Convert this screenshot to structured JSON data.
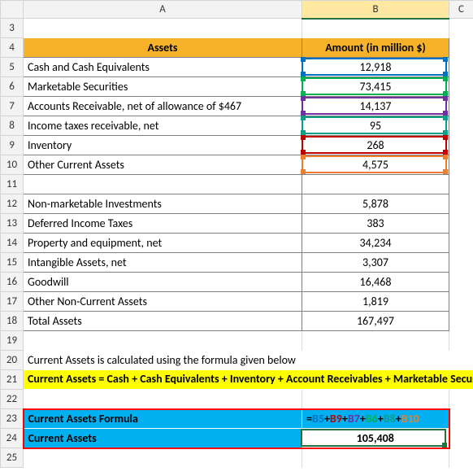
{
  "columns": {
    "rowhead": "",
    "A": "A",
    "B": "B",
    "C": "C"
  },
  "rows": [
    "3",
    "4",
    "5",
    "6",
    "7",
    "8",
    "9",
    "10",
    "11",
    "12",
    "13",
    "14",
    "15",
    "16",
    "17",
    "18",
    "19",
    "20",
    "21",
    "22",
    "23",
    "24",
    "25"
  ],
  "header": {
    "assets": "Assets",
    "amount": "Amount (in million $)"
  },
  "assets_current": [
    {
      "label": "Cash and Cash Equivalents",
      "value": "12,918"
    },
    {
      "label": "Marketable Securities",
      "value": "73,415"
    },
    {
      "label": "Accounts Receivable, net of allowance of $467",
      "value": "14,137"
    },
    {
      "label": "Income taxes receivable, net",
      "value": "95"
    },
    {
      "label": "Inventory",
      "value": "268"
    },
    {
      "label": "Other Current Assets",
      "value": "4,575"
    }
  ],
  "assets_noncurrent": [
    {
      "label": "Non-marketable Investments",
      "value": "5,878"
    },
    {
      "label": "Deferred Income Taxes",
      "value": "383"
    },
    {
      "label": "Property and equipment, net",
      "value": "34,234"
    },
    {
      "label": "Intangible Assets, net",
      "value": "3,307"
    },
    {
      "label": "Goodwill",
      "value": "16,468"
    },
    {
      "label": "Other Non-Current Assets",
      "value": "1,819"
    },
    {
      "label": "Total Assets",
      "value": "167,497"
    }
  ],
  "note_line": "Current Assets is calculated using the formula given below",
  "formula_note": "Current Assets = Cash + Cash Equivalents + Inventory + Account Receivables + Marketable Securities + Prepaid Expenses + Other Liquid Assets",
  "result": {
    "formula_label": "Current Assets Formula",
    "formula_tokens": [
      "=",
      "B5",
      "+",
      "B9",
      "+",
      "B7",
      "+",
      "B6",
      "+",
      "B8",
      "+",
      "B10"
    ],
    "formula_colors": [
      "tok-eq",
      "tok-blue",
      "tok-eq",
      "tok-red",
      "tok-eq",
      "tok-purple",
      "tok-eq",
      "tok-green",
      "tok-eq",
      "tok-teal",
      "tok-eq",
      "tok-orange"
    ],
    "value_label": "Current Assets",
    "value": "105,408"
  },
  "ref_outlines": [
    {
      "row": 5,
      "color": "#0070c0"
    },
    {
      "row": 6,
      "color": "#00b050"
    },
    {
      "row": 7,
      "color": "#7030a0"
    },
    {
      "row": 8,
      "color": "#0d9e8a"
    },
    {
      "row": 9,
      "color": "#c00000"
    },
    {
      "row": 10,
      "color": "#ed7d31"
    }
  ],
  "chart_data": {
    "type": "table",
    "title": "Assets — Amount (in million $)",
    "rows": [
      [
        "Cash and Cash Equivalents",
        12918
      ],
      [
        "Marketable Securities",
        73415
      ],
      [
        "Accounts Receivable, net of allowance of $467",
        14137
      ],
      [
        "Income taxes receivable, net",
        95
      ],
      [
        "Inventory",
        268
      ],
      [
        "Other Current Assets",
        4575
      ],
      [
        "Non-marketable Investments",
        5878
      ],
      [
        "Deferred Income Taxes",
        383
      ],
      [
        "Property and equipment, net",
        34234
      ],
      [
        "Intangible Assets, net",
        3307
      ],
      [
        "Goodwill",
        16468
      ],
      [
        "Other Non-Current Assets",
        1819
      ],
      [
        "Total Assets",
        167497
      ]
    ],
    "derived": {
      "Current Assets": 105408,
      "formula": "=B5+B9+B7+B6+B8+B10"
    }
  }
}
